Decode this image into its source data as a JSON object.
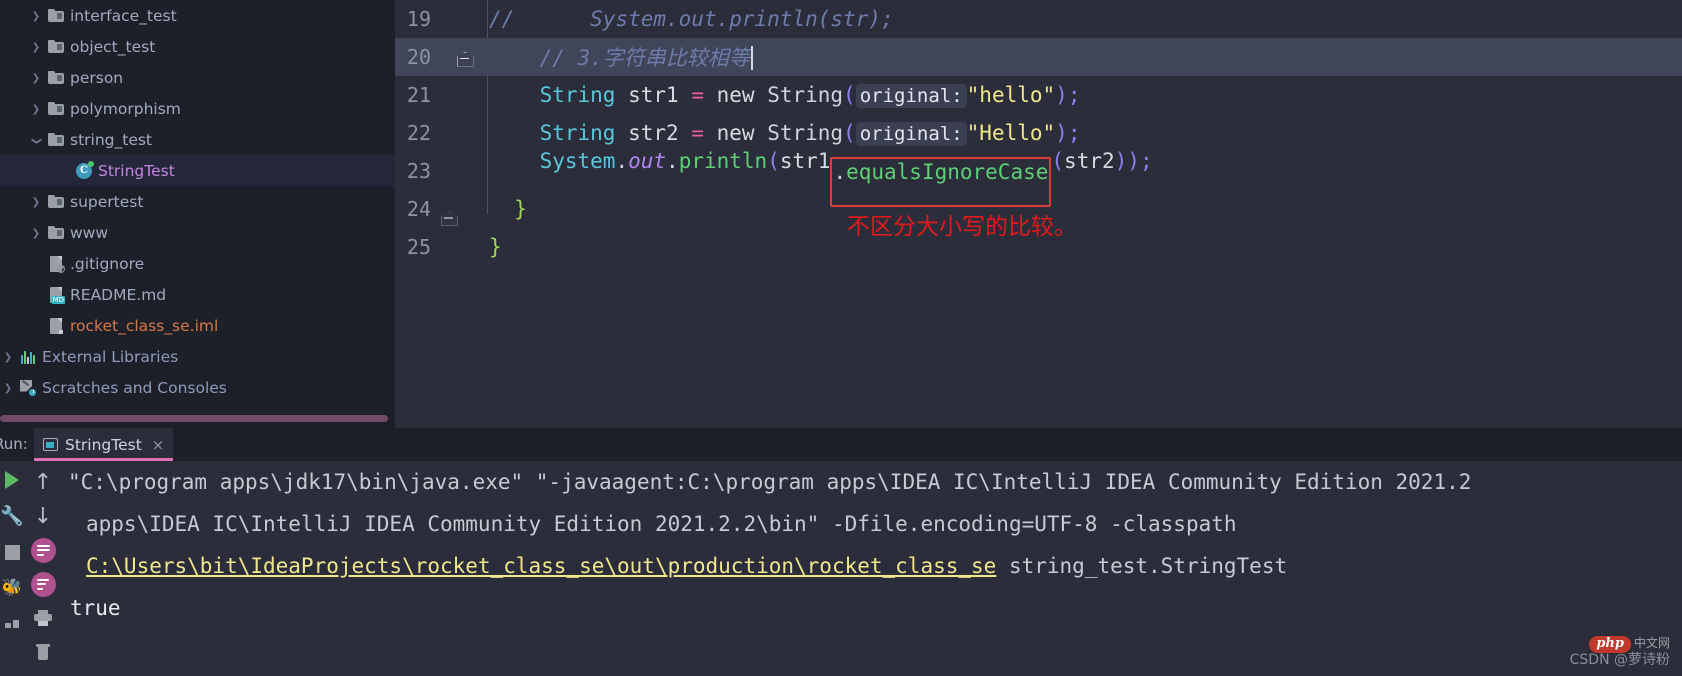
{
  "project_tree": {
    "items": [
      {
        "label": "interface_test",
        "icon": "folder-icon",
        "state": "collapsed",
        "indent": 0,
        "color": "#a0aac0",
        "selected": false
      },
      {
        "label": "object_test",
        "icon": "folder-icon",
        "state": "collapsed",
        "indent": 0,
        "color": "#a0aac0",
        "selected": false
      },
      {
        "label": "person",
        "icon": "folder-icon",
        "state": "collapsed",
        "indent": 0,
        "color": "#a0aac0",
        "selected": false
      },
      {
        "label": "polymorphism",
        "icon": "folder-icon",
        "state": "collapsed",
        "indent": 0,
        "color": "#a0aac0",
        "selected": false
      },
      {
        "label": "string_test",
        "icon": "folder-icon",
        "state": "expanded",
        "indent": 0,
        "color": "#a0aac0",
        "selected": false
      },
      {
        "label": "StringTest",
        "icon": "java-class-icon",
        "state": "none",
        "indent": 1,
        "color": "#c586e0",
        "selected": true
      },
      {
        "label": "supertest",
        "icon": "folder-icon",
        "state": "collapsed",
        "indent": 0,
        "color": "#a0aac0",
        "selected": false
      },
      {
        "label": "www",
        "icon": "folder-icon",
        "state": "collapsed",
        "indent": 0,
        "color": "#a0aac0",
        "selected": false
      },
      {
        "label": ".gitignore",
        "icon": "gitignore-file-icon",
        "state": "none",
        "indent": 0,
        "color": "#a0aac0",
        "selected": false
      },
      {
        "label": "README.md",
        "icon": "markdown-file-icon",
        "state": "none",
        "indent": 0,
        "color": "#a0aac0",
        "selected": false
      },
      {
        "label": "rocket_class_se.iml",
        "icon": "iml-file-icon",
        "state": "none",
        "indent": 0,
        "color": "#d4784a",
        "selected": false
      },
      {
        "label": "External Libraries",
        "icon": "external-libraries-icon",
        "state": "collapsed",
        "indent": -1,
        "color": "#8f9bbd",
        "selected": false
      },
      {
        "label": "Scratches and Consoles",
        "icon": "scratches-icon",
        "state": "collapsed",
        "indent": -1,
        "color": "#8f9bbd",
        "selected": false
      }
    ]
  },
  "editor": {
    "lines": [
      {
        "number": "19",
        "current": false,
        "fold": "none"
      },
      {
        "number": "20",
        "current": true,
        "fold": "filled"
      },
      {
        "number": "21",
        "current": false,
        "fold": "none"
      },
      {
        "number": "22",
        "current": false,
        "fold": "none"
      },
      {
        "number": "23",
        "current": false,
        "fold": "none"
      },
      {
        "number": "24",
        "current": false,
        "fold": "closed"
      },
      {
        "number": "25",
        "current": false,
        "fold": "none"
      }
    ],
    "code": {
      "line19_comment_slashes": "//",
      "line19_comment_body": "      System.out.println(str);",
      "line20_comment": "// 3.字符串比较相等",
      "line21": {
        "type": "String",
        "space1": " ",
        "var": "str1",
        "eq": " = ",
        "kw": "new ",
        "ctor": "String",
        "open": "(",
        "hint": "original:",
        "value": "\"hello\"",
        "close": ")",
        "semi": ";"
      },
      "line22": {
        "type": "String",
        "space1": " ",
        "var": "str2",
        "eq": " = ",
        "kw": "new ",
        "ctor": "String",
        "open": "(",
        "hint": "original:",
        "value": "\"Hello\"",
        "close": ")",
        "semi": ";"
      },
      "line23": {
        "sys": "System",
        "dot1": ".",
        "field": "out",
        "dot2": ".",
        "method": "println",
        "open": "(",
        "arg1": "str1",
        "dot3": ".",
        "boxed": "equalsIgnoreCase",
        "open2": "(",
        "arg2": "str2",
        "close2": ")",
        "close": ")",
        "semi": ";"
      },
      "line24_brace": "}",
      "line25_brace": "}"
    },
    "annotation_red": "不区分大小写的比较。"
  },
  "run_panel": {
    "run_label": "Run:",
    "tab": {
      "title": "StringTest",
      "close": "×"
    },
    "toolbar_left": [
      {
        "name": "rerun-button",
        "icon": "play-icon"
      },
      {
        "name": "edit-configuration-button",
        "icon": "wrench-icon"
      },
      {
        "name": "stop-button",
        "icon": "stop-icon"
      },
      {
        "name": "coverage-button",
        "icon": "bug-icon"
      },
      {
        "name": "layout-button",
        "icon": "layout-icon"
      }
    ],
    "toolbar_right": [
      {
        "name": "up-button",
        "icon": "arrow-up-icon"
      },
      {
        "name": "down-button",
        "icon": "arrow-down-icon"
      },
      {
        "name": "soft-wrap-button",
        "icon": "soft-wrap-icon"
      },
      {
        "name": "scroll-to-end-button",
        "icon": "scroll-to-end-icon"
      },
      {
        "name": "print-button",
        "icon": "print-icon"
      },
      {
        "name": "clear-all-button",
        "icon": "trash-icon"
      }
    ],
    "console": {
      "line1": "\"C:\\program apps\\jdk17\\bin\\java.exe\" \"-javaagent:C:\\program apps\\IDEA IC\\IntelliJ IDEA Community Edition 2021.2",
      "line2": "apps\\IDEA IC\\IntelliJ IDEA Community Edition 2021.2.2\\bin\" -Dfile.encoding=UTF-8 -classpath",
      "line3_link": "C:\\Users\\bit\\IdeaProjects\\rocket_class_se\\out\\production\\rocket_class_se",
      "line3_rest": " string_test.StringTest",
      "line4": "true"
    }
  },
  "watermark": {
    "php_logo": "php",
    "php_cn": "中文网",
    "csdn": "CSDN @萝诗粉"
  },
  "colors": {
    "tree_bg": "#1e2029",
    "editor_bg": "#2b2d3a",
    "current_line": "#41455a",
    "accent_pink": "#e06fb6",
    "red_annotation": "#e01b1b",
    "link_yellow": "#f0e68c"
  }
}
